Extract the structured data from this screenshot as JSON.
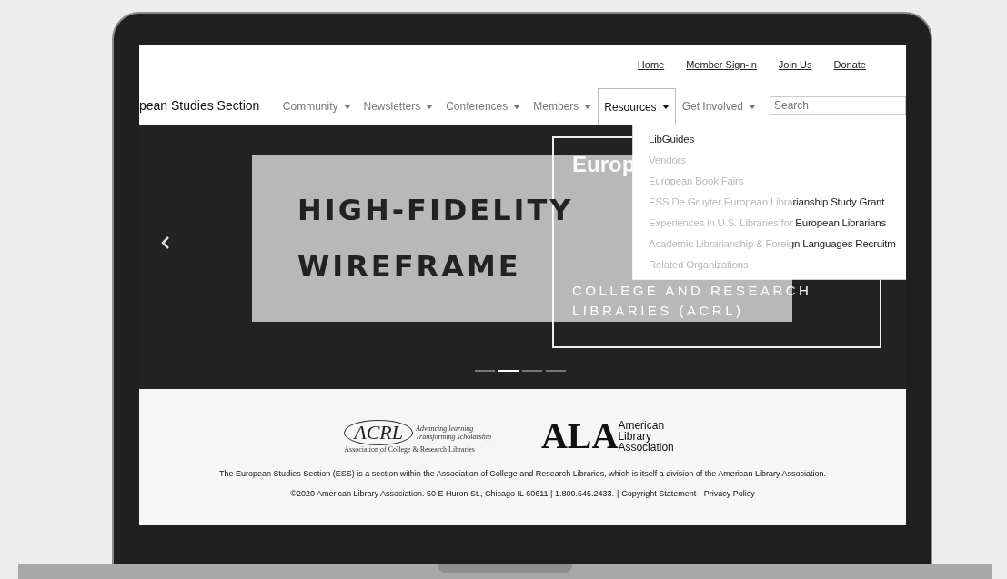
{
  "top_links": [
    "Home",
    "Member Sign-in",
    "Join Us",
    "Donate"
  ],
  "brand": "pean Studies Section",
  "nav": [
    {
      "label": "Community",
      "selected": false
    },
    {
      "label": "Newsletters",
      "selected": false
    },
    {
      "label": "Conferences",
      "selected": false
    },
    {
      "label": "Members",
      "selected": false
    },
    {
      "label": "Resources",
      "selected": true
    },
    {
      "label": "Get Involved",
      "selected": false
    }
  ],
  "search": {
    "placeholder": "Search"
  },
  "dropdown": [
    "LibGuides",
    "Vendors",
    "European Book Fairs",
    "ESS De Gruyter European Librarianship Study Grant",
    "Experiences in U.S. Libraries for European Librarians",
    "Academic Librarianship & Foreign Languages Recruitm",
    "Related Organizations"
  ],
  "hero": {
    "title_lines": [
      "Europ"
    ],
    "subtitle_lines": [
      "COLLEGE AND RESEARCH",
      "LIBRARIES (ACRL)"
    ],
    "indicators": [
      {
        "selected": false
      },
      {
        "selected": true
      },
      {
        "selected": false
      },
      {
        "selected": false
      }
    ]
  },
  "overlay": {
    "lines": [
      "HIGH-FIDELITY",
      "WIREFRAME"
    ]
  },
  "footer": {
    "acrl_logo": {
      "letters": "ACRL",
      "tagline_lines": [
        "Advancing learning",
        "Transforming scholarship"
      ],
      "name": "Association of College & Research Libraries"
    },
    "ala_logo": {
      "letters": "ALA",
      "name_lines": [
        "American",
        "Library",
        "Association"
      ]
    },
    "description": "The European Studies Section (ESS) is a section within the Association of College and Research Libraries, which is itself a division of the American Library Association.",
    "copyright": "©2020 American Library Association. 50 E Huron St., Chicago IL 60611 | 1.800.545.2433.",
    "separator": "|",
    "links": [
      "Copyright Statement",
      "Privacy Policy"
    ]
  }
}
